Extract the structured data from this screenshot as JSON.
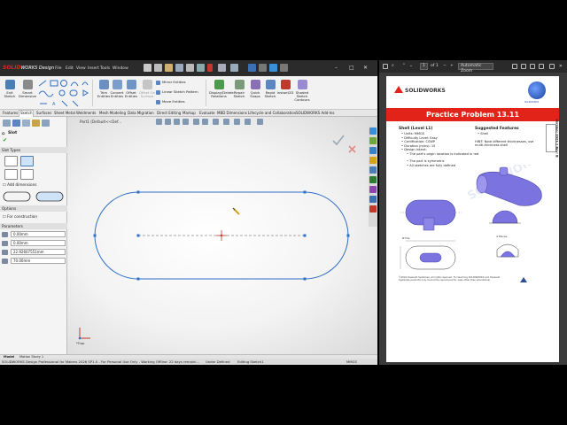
{
  "solidworks": {
    "logo_brand": "SOLID",
    "logo_rest": "WORKS Design",
    "menu": [
      "File",
      "Edit",
      "View",
      "Insert",
      "Tools",
      "Window"
    ],
    "ribbon": {
      "exit_sketch": "Exit Sketch",
      "smart_dimension": "Smart Dimension",
      "trim_entities": "Trim Entities",
      "convert_entities": "Convert Entities",
      "offset_entities": "Offset Entities",
      "offset_on_surface": "Offset On Surface",
      "mirror_entities": "Mirror Entities",
      "linear_sketch_pattern": "Linear Sketch Pattern",
      "move_entities": "Move Entities",
      "display_delete_relations": "Display/Delete Relations",
      "repair_sketch": "Repair Sketch",
      "quick_snaps": "Quick Snaps",
      "rapid_sketch": "Rapid Sketch",
      "instant2d": "Instant2D",
      "shaded_sketch_contours": "Shaded Sketch Contours"
    },
    "command_tabs": [
      "Features",
      "Sketch",
      "Surfaces",
      "Sheet Metal",
      "Weldments",
      "Mesh Modeling",
      "Data Migration",
      "Direct Editing",
      "Markup",
      "Evaluate",
      "MBD Dimensions",
      "Lifecycle and Collaboration",
      "SOLIDWORKS Add-Ins"
    ],
    "active_tab": "Sketch",
    "doc_title": "Part1 (Default<<Def...",
    "panel": {
      "title": "Slot",
      "slot_types_header": "Slot Types",
      "add_dimensions": "Add dimensions",
      "options_header": "Options",
      "for_construction": "For construction",
      "parameters_header": "Parameters",
      "params": [
        "0.00mm",
        "0.00mm",
        "22.92607551mm",
        "70.00mm"
      ]
    },
    "triad_label": "*Trap",
    "bottom_tabs": [
      "Model",
      "Motion Study 1"
    ],
    "status": {
      "left": "SOLIDWORKS Design Professional for Makers 2026 SP1.0 - For Personal Use Only - Working Offline: 22 days remaini...",
      "state": "Under Defined",
      "mode": "Editing Sketch1",
      "units": "MMGS"
    }
  },
  "pdf": {
    "page_current": "1",
    "page_total": "of 1",
    "zoom": "Automatic Zoom",
    "logo_text": "SOLIDWORKS",
    "title": "Practice Problem 13.11",
    "left_heading": "Shell (Level L1)",
    "left_items": [
      "Units: MMGS",
      "Difficulty Level: Easy",
      "Certification: CSWP",
      "Duration (mins): 15",
      "Design Intent:"
    ],
    "intent_items": [
      "The part's origin location is indicated in red",
      "The part is symmetric",
      "All sketches are fully defined"
    ],
    "right_heading": "Suggested Features",
    "right_items": [
      "Shell"
    ],
    "hint": "HINT: Note different thicknesses, use multi-thickness shell",
    "side_tag": "Version: 2023.1 Rev: B",
    "watermark": "SOLIDWORKS",
    "footer": "©2024 Dassault Systèmes. All rights reserved. For teaching SOLIDWORKS and Dassault Systèmes products only. Cannot be reproduced for uses other than educational.",
    "dim_left": "Ø Dia.",
    "dim_right": "4 Places"
  },
  "colors": {
    "sw_red": "#e2231a",
    "sketch_blue": "#2f6fc4",
    "model_purple": "#7b74e0"
  }
}
